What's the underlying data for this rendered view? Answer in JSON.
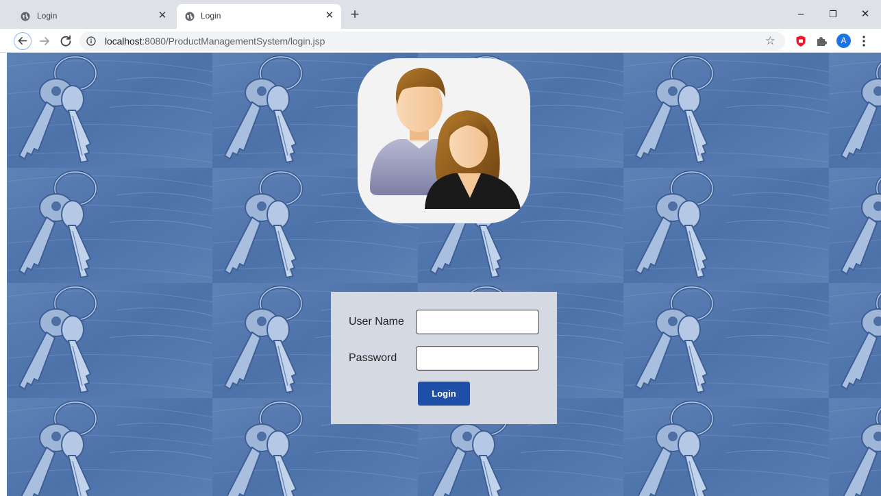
{
  "browser": {
    "tabs": [
      {
        "title": "Login",
        "icon": "globe-icon",
        "active": false
      },
      {
        "title": "Login",
        "icon": "globe-icon",
        "active": true
      }
    ],
    "new_tab_label": "+",
    "window_controls": {
      "minimize": "–",
      "restore": "❐",
      "close": "✕"
    },
    "address": {
      "host": "localhost",
      "rest": ":8080/ProductManagementSystem/login.jsp"
    },
    "profile_initial": "A",
    "extension_icons": [
      "shield-extension-icon",
      "puzzle-extensions-icon"
    ]
  },
  "page": {
    "background_image": "keys-tiled-background",
    "logo": "users-avatar-logo",
    "form": {
      "username_label": "User Name",
      "password_label": "Password",
      "username_value": "",
      "password_value": "",
      "submit_label": "Login"
    }
  },
  "colors": {
    "panel_bg": "#d5d9e3",
    "button_bg": "#1f4fa9",
    "background_tint": "#5a7db3"
  }
}
